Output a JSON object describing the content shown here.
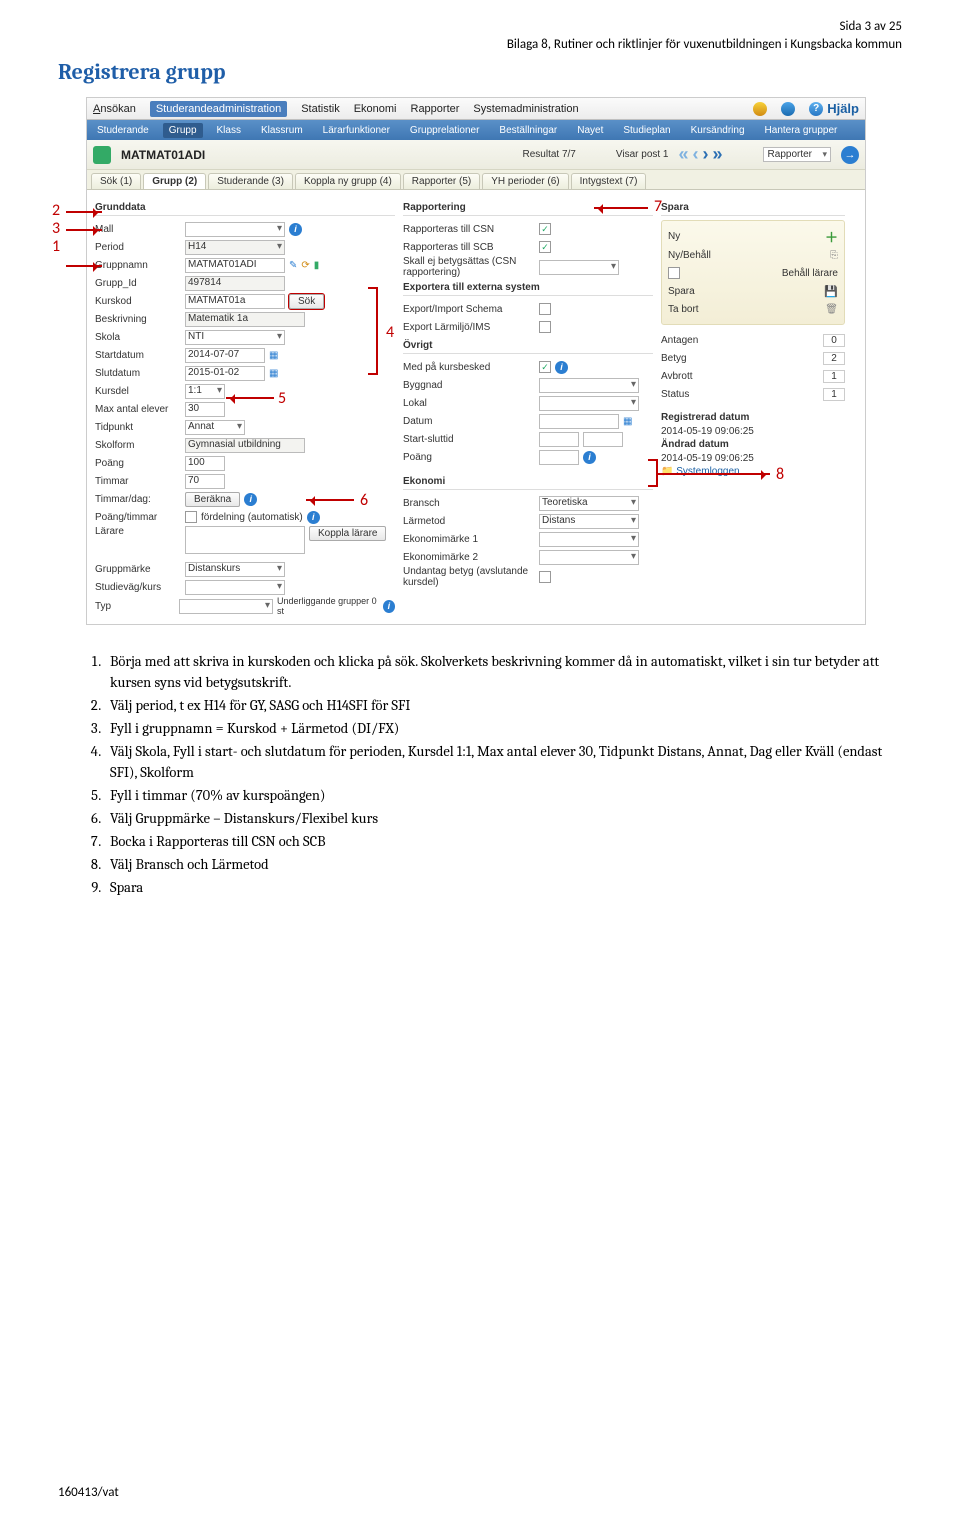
{
  "header": {
    "page_num": "Sida 3 av 25",
    "subtitle": "Bilaga 8, Rutiner och riktlinjer för vuxenutbildningen i Kungsbacka kommun"
  },
  "title": "Registrera grupp",
  "annotations": {
    "n1": "1",
    "n2": "2",
    "n3": "3",
    "n4": "4",
    "n5": "5",
    "n6": "6",
    "n7": "7",
    "n8": "8"
  },
  "app": {
    "menubar": {
      "items": [
        "Ansökan",
        "Studerandeadministration",
        "Statistik",
        "Ekonomi",
        "Rapporter",
        "Systemadministration"
      ],
      "help": "Hjälp"
    },
    "toolbar": {
      "items": [
        "Studerande",
        "Grupp",
        "Klass",
        "Klassrum",
        "Lärarfunktioner",
        "Grupprelationer",
        "Beställningar",
        "Nayet",
        "Studieplan",
        "Kursändring",
        "Hantera grupper"
      ],
      "active_index": 1
    },
    "searchrow": {
      "code": "MATMAT01ADI",
      "result": "Resultat 7/7",
      "visar": "Visar post 1",
      "dropdown": "Rapporter"
    },
    "tabs": {
      "items": [
        "Sök (1)",
        "Grupp (2)",
        "Studerande (3)",
        "Koppla ny grupp (4)",
        "Rapporter (5)",
        "YH perioder (6)",
        "Intygstext (7)"
      ],
      "active_index": 1
    },
    "left": {
      "section": "Grunddata",
      "rows": {
        "mall": "Mall",
        "mall_val": "",
        "period": "Period",
        "period_val": "H14",
        "gruppnamn": "Gruppnamn",
        "gruppnamn_val": "MATMAT01ADI",
        "grupp_id": "Grupp_Id",
        "grupp_id_val": "497814",
        "kurskod": "Kurskod",
        "kurskod_val": "MATMAT01a",
        "kurskod_sok": "Sök",
        "beskrivning": "Beskrivning",
        "beskrivning_val": "Matematik 1a",
        "skola": "Skola",
        "skola_val": "NTI",
        "startdatum": "Startdatum",
        "startdatum_val": "2014-07-07",
        "slutdatum": "Slutdatum",
        "slutdatum_val": "2015-01-02",
        "kursdel": "Kursdel",
        "kursdel_val": "1:1",
        "max": "Max antal elever",
        "max_val": "30",
        "tidpunkt": "Tidpunkt",
        "tidpunkt_val": "Annat",
        "skolform": "Skolform",
        "skolform_val": "Gymnasial utbildning",
        "poang": "Poäng",
        "poang_val": "100",
        "timmar": "Timmar",
        "timmar_val": "70",
        "timdag": "Timmar/dag:",
        "berakna": "Beräkna",
        "poangtim": "Poäng/timmar",
        "fordelning": "fördelning (automatisk)",
        "larare": "Lärare",
        "koppla": "Koppla lärare",
        "gruppmarke": "Gruppmärke",
        "gruppmarke_val": "Distanskurs",
        "studievag": "Studieväg/kurs",
        "typ": "Typ",
        "underligg": "Underliggande grupper 0 st"
      }
    },
    "mid": {
      "sect_rapp": "Rapportering",
      "rapp_csn": "Rapporteras till CSN",
      "rapp_scb": "Rapporteras till SCB",
      "skall_ej": "Skall ej betygsättas (CSN rapportering)",
      "sect_exp": "Exportera till externa system",
      "exp_schema": "Export/Import Schema",
      "exp_lm": "Export Lärmiljö/IMS",
      "sect_ovrigt": "Övrigt",
      "med_pa": "Med på kursbesked",
      "byggnad": "Byggnad",
      "lokal": "Lokal",
      "datum": "Datum",
      "start_slut": "Start-sluttid",
      "poang": "Poäng",
      "sect_ek": "Ekonomi",
      "bransch": "Bransch",
      "bransch_val": "Teoretiska",
      "larmetod": "Lärmetod",
      "larmetod_val": "Distans",
      "ekmark1": "Ekonomimärke 1",
      "ekmark2": "Ekonomimärke 2",
      "undantag": "Undantag betyg (avslutande kursdel)"
    },
    "right": {
      "sect_spara": "Spara",
      "ny": "Ny",
      "nybehall": "Ny/Behåll",
      "behall_larare": "Behåll lärare",
      "spara": "Spara",
      "tabort": "Ta bort",
      "stats": {
        "antagen": "Antagen",
        "antagen_v": "0",
        "betyg": "Betyg",
        "betyg_v": "2",
        "avbrott": "Avbrott",
        "avbrott_v": "1",
        "status": "Status",
        "status_v": "1"
      },
      "reg_lbl": "Registrerad datum",
      "reg_val": "2014-05-19 09:06:25",
      "andr_lbl": "Ändrad datum",
      "andr_val": "2014-05-19 09:06:25",
      "syslog": "Systemloggen"
    }
  },
  "instructions": {
    "items": [
      "Börja med att skriva in kurskoden och klicka på sök. Skolverkets beskrivning kommer då in automatiskt, vilket i sin tur betyder att kursen syns vid betygsutskrift.",
      "Välj period, t ex H14 för GY, SASG och H14SFI för SFI",
      "Fyll i gruppnamn = Kurskod + Lärmetod (DI/FX)",
      "Välj Skola, Fyll i start- och slutdatum för perioden, Kursdel 1:1, Max antal elever 30, Tidpunkt Distans, Annat, Dag eller Kväll (endast SFI), Skolform",
      "Fyll i timmar (70% av kurspoängen)",
      "Välj Gruppmärke – Distanskurs/Flexibel kurs",
      "Bocka i Rapporteras till CSN och SCB",
      "Välj Bransch och Lärmetod",
      "Spara"
    ]
  },
  "footer": "160413/vat"
}
